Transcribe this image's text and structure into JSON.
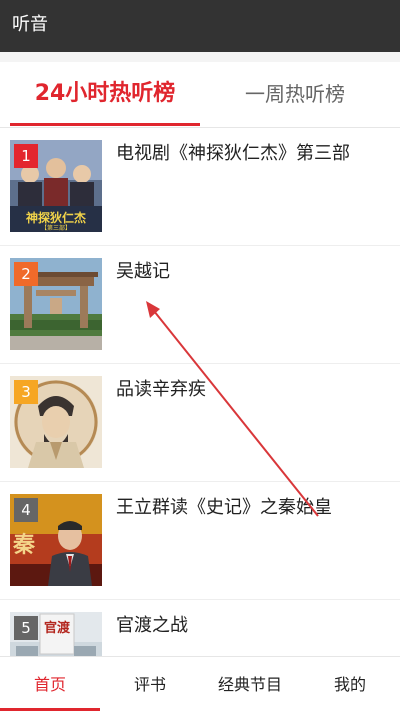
{
  "header": {
    "title": "听音"
  },
  "tabs": [
    {
      "label": "24小时热听榜",
      "active": true
    },
    {
      "label": "一周热听榜",
      "active": false
    }
  ],
  "list": [
    {
      "rank": "1",
      "title": "电视剧《神探狄仁杰》第三部",
      "thumb_caption": "神探狄仁杰",
      "thumb_sub": "【第三部】"
    },
    {
      "rank": "2",
      "title": "吴越记"
    },
    {
      "rank": "3",
      "title": "品读辛弃疾"
    },
    {
      "rank": "4",
      "title": "王立群读《史记》之秦始皇",
      "thumb_caption": "秦"
    },
    {
      "rank": "5",
      "title": "官渡之战",
      "thumb_caption": "官渡"
    }
  ],
  "bottom_nav": [
    {
      "label": "首页",
      "active": true
    },
    {
      "label": "评书",
      "active": false
    },
    {
      "label": "经典节目",
      "active": false
    },
    {
      "label": "我的",
      "active": false
    }
  ],
  "colors": {
    "accent": "#e0262e",
    "titlebar": "#333333"
  }
}
